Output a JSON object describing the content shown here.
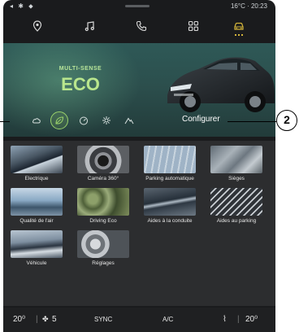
{
  "status": {
    "signal_icons": "◂ ✱ ⬥",
    "temp_time": "16°C · 20:23"
  },
  "nav": [
    {
      "name": "nav-location-icon"
    },
    {
      "name": "nav-music-icon"
    },
    {
      "name": "nav-phone-icon"
    },
    {
      "name": "nav-apps-icon"
    },
    {
      "name": "nav-vehicle-icon",
      "active": true
    }
  ],
  "hero": {
    "subtitle": "MULTI-SENSE",
    "mode": "ECO",
    "configure_label": "Configurer",
    "mode_icons": [
      "cloud-icon",
      "leaf-icon",
      "speedometer-icon",
      "gear-icon",
      "mountain-icon"
    ],
    "active_mode_index": 1
  },
  "tiles": [
    {
      "label": "Electrique"
    },
    {
      "label": "Caméra 360°"
    },
    {
      "label": "Parking automatique"
    },
    {
      "label": "Sièges"
    },
    {
      "label": "Qualité de l'air"
    },
    {
      "label": "Driving Eco"
    },
    {
      "label": "Aides à la conduite"
    },
    {
      "label": "Aides au parking"
    },
    {
      "label": "Véhicule"
    },
    {
      "label": "Réglages"
    }
  ],
  "bottom": {
    "temp_left": "20⁰",
    "fan_level": "5",
    "sync": "SYNC",
    "ac": "A/C",
    "temp_right": "20⁰"
  },
  "callout_number": "2",
  "colors": {
    "accent_green": "#9ad26b",
    "nav_active": "#d3b43a"
  }
}
